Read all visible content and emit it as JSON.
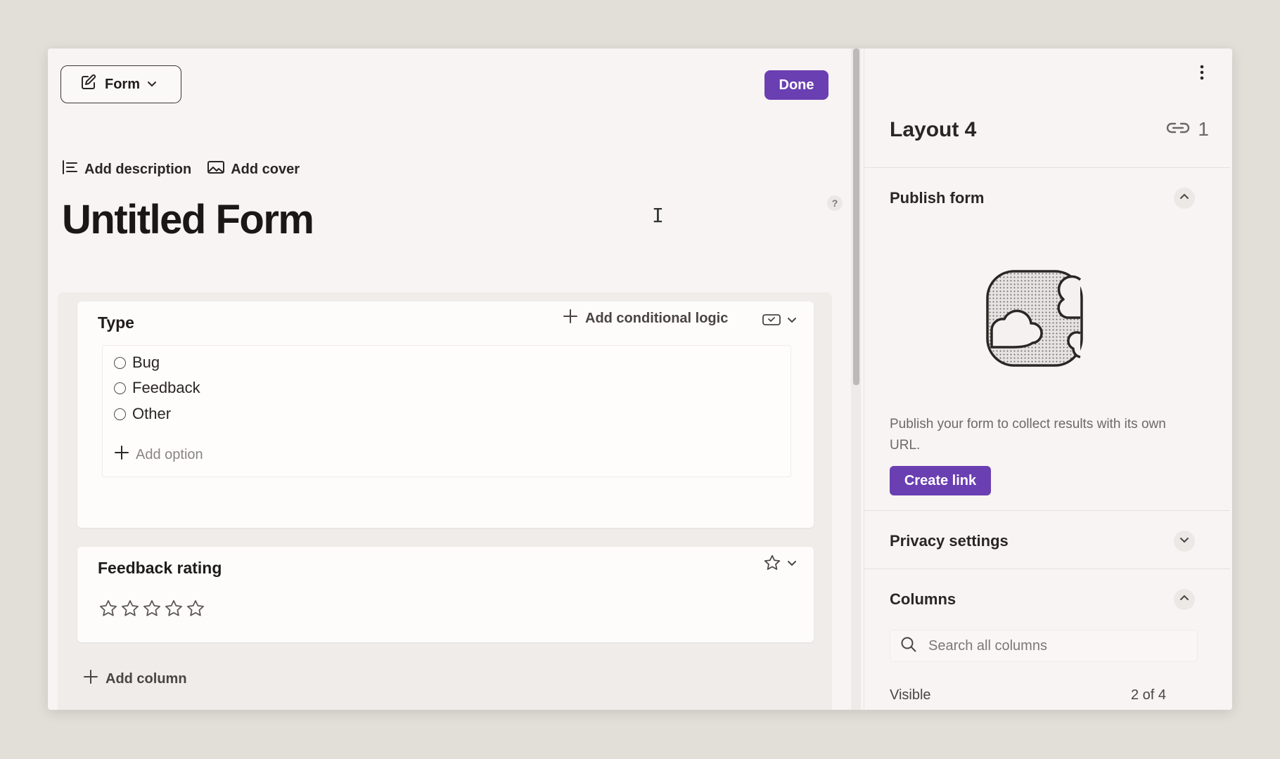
{
  "header": {
    "form_menu_label": "Form",
    "done_label": "Done"
  },
  "meta": {
    "add_description": "Add description",
    "add_cover": "Add cover"
  },
  "form": {
    "title": "Untitled Form",
    "help": "?"
  },
  "questions": {
    "type": {
      "title": "Type",
      "conditional_logic_label": "Add conditional logic",
      "options": [
        "Bug",
        "Feedback",
        "Other"
      ],
      "add_option_label": "Add option"
    },
    "rating": {
      "title": "Feedback rating",
      "star_count": 5
    }
  },
  "add_column_label": "Add column",
  "sidebar": {
    "title": "Layout 4",
    "link_count": "1",
    "publish": {
      "title": "Publish form",
      "description": "Publish your form to collect results with its own URL.",
      "create_link_label": "Create link"
    },
    "privacy": {
      "title": "Privacy settings"
    },
    "columns": {
      "title": "Columns",
      "search_placeholder": "Search all columns",
      "visible_label": "Visible",
      "visible_count": "2 of 4"
    }
  },
  "colors": {
    "accent": "#6a3fb2",
    "background": "#e2dfd9",
    "panel": "#f8f4f3"
  },
  "icons": [
    "form-edit-icon",
    "chevron-down-icon",
    "description-icon",
    "image-icon",
    "plus-icon",
    "radio-type-icon",
    "star-icon",
    "kebab-icon",
    "link-icon",
    "chevron-up-icon",
    "search-icon"
  ]
}
